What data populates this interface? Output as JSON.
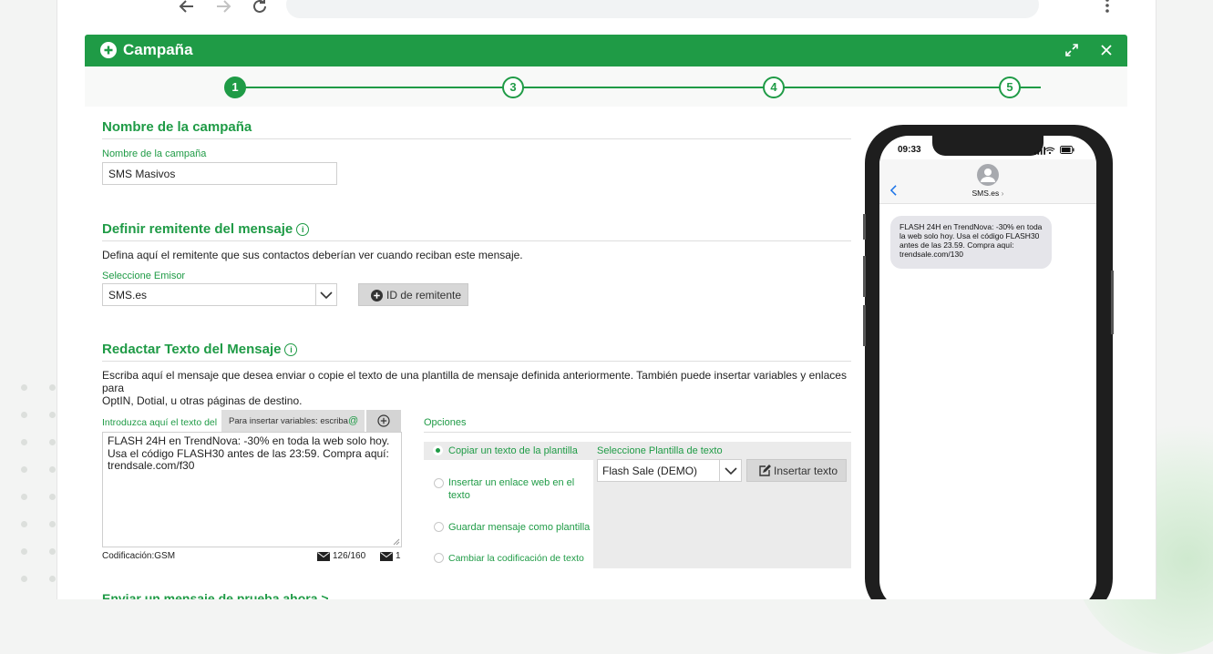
{
  "modal": {
    "title": "Campaña",
    "steps": [
      "1",
      "3",
      "4",
      "5"
    ],
    "active_step": "1"
  },
  "campaign_name": {
    "section_title": "Nombre de la campaña",
    "field_label": "Nombre de la campaña",
    "value": "SMS Masivos"
  },
  "sender": {
    "section_title": "Definir remitente del mensaje",
    "description": "Defina aquí el remitente que sus contactos deberían ver cuando reciban este mensaje.",
    "select_label": "Seleccione Emisor",
    "selected": "SMS.es",
    "id_button": "ID de remitente"
  },
  "message": {
    "section_title": "Redactar Texto del Mensaje",
    "description_line1": "Escriba aquí el mensaje que desea enviar o copie el texto de una plantilla de mensaje definida anteriormente. También puede insertar variables y enlaces para",
    "description_line2": "OptIN, Dotial, u otras páginas de destino.",
    "input_label": "Introduzca aquí el texto del m",
    "variables_hint": "Para insertar variables: escriba",
    "text": "FLASH 24H en TrendNova: -30% en toda la web solo hoy. Usa el código FLASH30 antes de las 23:59. Compra aquí: trendsale.com/f30",
    "encoding": "Codificación:GSM",
    "char_count": "126/160",
    "sms_count": "1"
  },
  "options": {
    "title": "Opciones",
    "items": [
      {
        "label": "Copiar un texto de la plantilla",
        "selected": true
      },
      {
        "label": "Insertar un enlace web en el texto",
        "selected": false
      },
      {
        "label": "Guardar mensaje como plantilla",
        "selected": false
      },
      {
        "label": "Cambiar la codificación de texto",
        "selected": false
      }
    ],
    "template_label": "Seleccione Plantilla de texto",
    "template_selected": "Flash Sale (DEMO)",
    "insert_button": "Insertar texto"
  },
  "test_link": "Enviar un mensaje de prueba ahora >",
  "phone": {
    "time": "09:33",
    "contact": "SMS.es",
    "message": "FLASH 24H en TrendNova: -30% en toda la web solo hoy. Usa el código FLASH30 antes de las 23.59. Compra aquí: trendsale.com/130"
  },
  "colors": {
    "accent": "#1f9b46"
  }
}
